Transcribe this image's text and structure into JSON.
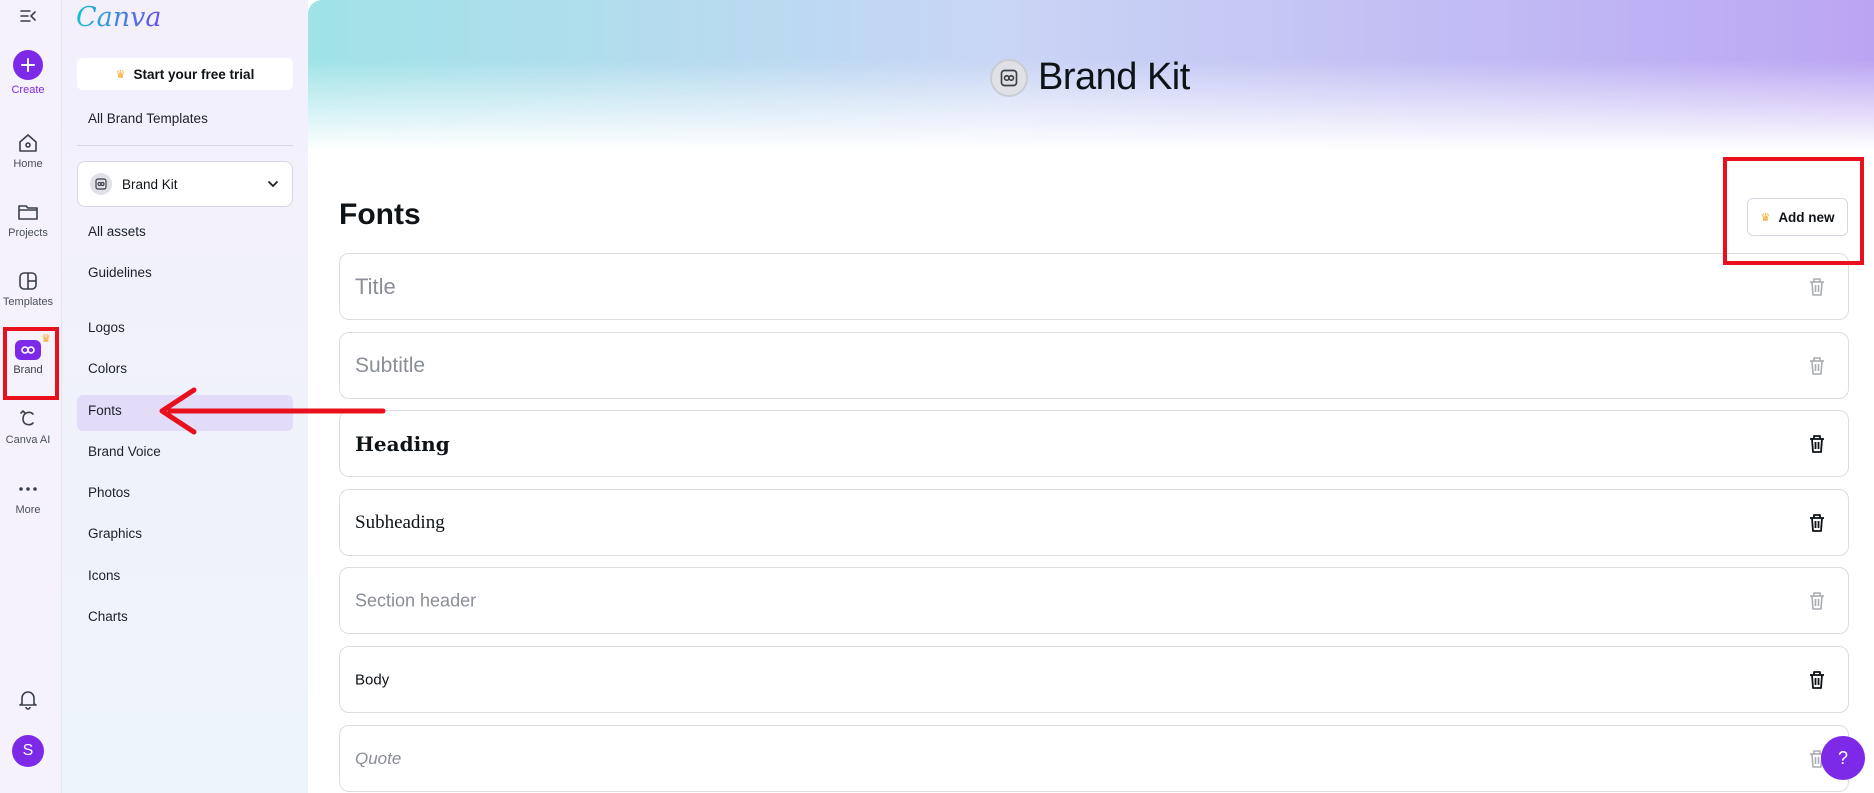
{
  "rail": {
    "create_label": "Create",
    "items": [
      {
        "label": "Home",
        "icon": "home-icon"
      },
      {
        "label": "Projects",
        "icon": "folder-icon"
      },
      {
        "label": "Templates",
        "icon": "templates-icon"
      },
      {
        "label": "Brand",
        "icon": "brand-icon"
      },
      {
        "label": "Canva AI",
        "icon": "canva-ai-icon"
      },
      {
        "label": "More",
        "icon": "more-icon"
      }
    ],
    "avatar_initial": "S"
  },
  "sidebar": {
    "logo": "Canva",
    "trial_label": "Start your free trial",
    "all_templates": "All Brand Templates",
    "kit_select": "Brand Kit",
    "links": [
      "All assets",
      "Guidelines",
      "Logos",
      "Colors",
      "Fonts",
      "Brand Voice",
      "Photos",
      "Graphics",
      "Icons",
      "Charts"
    ],
    "active_link": "Fonts"
  },
  "main": {
    "page_title": "Brand Kit",
    "section_title": "Fonts",
    "add_new_label": "Add new",
    "font_rows": [
      {
        "label": "Title",
        "state": "placeholder"
      },
      {
        "label": "Subtitle",
        "state": "placeholder"
      },
      {
        "label": "Heading",
        "state": "set"
      },
      {
        "label": "Subheading",
        "state": "set"
      },
      {
        "label": "Section header",
        "state": "placeholder"
      },
      {
        "label": "Body",
        "state": "set"
      },
      {
        "label": "Quote",
        "state": "placeholder"
      }
    ],
    "help_label": "?"
  },
  "colors": {
    "accent": "#7d2ae8",
    "annotation": "#e8101d",
    "crown": "#f5a623"
  }
}
